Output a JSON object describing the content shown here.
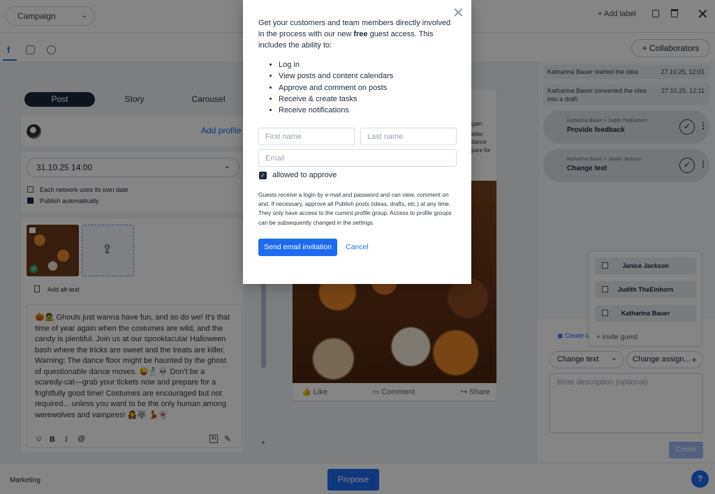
{
  "topbar": {
    "campaign_select": "Campaign",
    "add_label": "+ Add label",
    "collaborators": "+ Collaborators"
  },
  "editor": {
    "tabs": [
      "Post",
      "Story",
      "Carousel"
    ],
    "active_tab": "Post",
    "add_profile": "Add profile",
    "date_value": "31.10.25  14:00",
    "each_network_date": "Each network uses its own date",
    "publish_auto": "Publish automatically",
    "add_alt_text": "Add alt-text",
    "post_text": "🎃🧟 Ghouls just wanna have fun, and so do we! It's that time of year again when the costumes are wild, and the candy is plentiful. Join us at our spooktacular Halloween bash where the tricks are sweet and the treats are killer. Warning: The dance floor might be haunted by the ghost of questionable dance moves. 😜🕺💀 Don't be a scaredy-cat—grab your tickets now and prepare for a frightfully good time! Costumes are encouraged but not required... unless you want to be the only human among werewolves and vampires! 🧛‍♀️🐺 💃👻"
  },
  "preview": {
    "partial_lines": [
      "gain",
      "killer.",
      "dance",
      "pare for"
    ],
    "like": "Like",
    "comment": "Comment",
    "share": "Share"
  },
  "modal": {
    "intro_before": "Get your customers and team members directly involved in the process with our new ",
    "intro_bold": "free",
    "intro_after": " guest access. This includes the ability to:",
    "abilities": [
      "Log in",
      "View posts and content calendars",
      "Approve and comment on posts",
      "Receive & create tasks",
      "Receive notifications"
    ],
    "first_name_placeholder": "First name",
    "last_name_placeholder": "Last name",
    "email_placeholder": "Email",
    "allowed_to_approve": "allowed to approve",
    "description": "Guests receive a login by e-mail and password and can view, comment on and, if necessary, approve all Publish posts (ideas, drafts, etc.) at any time. They only have access to the current profile group. Access to profile groups can be subsequently changed in the settings.",
    "send_button": "Send email invitation",
    "cancel": "Cancel"
  },
  "activity": {
    "timeline": [
      {
        "text": "Katharina Bauer started the idea",
        "time": "27.10.25, 12:01"
      },
      {
        "text": "Katharina Bauer converted the idea into a draft.",
        "time": "27.10.25, 12:11"
      }
    ],
    "tasks": [
      {
        "assign": "Katharina Bauer > Judith TheEinhorn",
        "title": "Provide feedback"
      },
      {
        "assign": "Katharina Bauer > Janice Jackson",
        "title": "Change text"
      }
    ],
    "members": [
      "Janice Jackson",
      "Judith TheEinhorn",
      "Katharina Bauer"
    ],
    "invite_guest": "+ invite guest",
    "create_task": "Create ta",
    "task_type": "Change text",
    "assign_placeholder": "Change assign...",
    "description_placeholder": "Write description (optional)",
    "create_button": "Create"
  },
  "footer": {
    "group": "Marketing",
    "propose": "Propose"
  },
  "colors": {
    "primary": "#1e6bf1",
    "dark": "#1e2a3a",
    "facebook": "#1877f2"
  }
}
